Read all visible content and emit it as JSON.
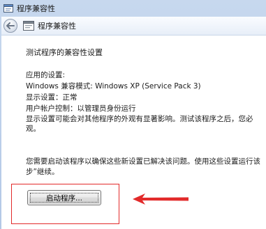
{
  "window": {
    "title": "程序兼容性"
  },
  "navbar": {
    "title": "程序兼容性"
  },
  "content": {
    "heading": "测试程序的兼容性设置",
    "applied_label": "应用的设置:",
    "compat_mode": "Windows 兼容模式: Windows XP (Service Pack 3)",
    "display_setting": "显示设置：正常",
    "uac": "用户帐户控制：以管理员身份运行",
    "warning_line1": "显示设置可能会对其他程序的外观有显著影响。测试该程序之后，您必",
    "warning_line2": "观。",
    "instruction_line1": "您需要启动该程序以确保这些新设置已解决该问题。使用这些设置运行该",
    "instruction_line2": "步”继续。",
    "start_button": "启动程序..."
  },
  "colors": {
    "highlight_box": "#e22a2a",
    "arrow": "#e22a2a"
  },
  "icons": {
    "title": "program-window-icon",
    "back": "back-arrow-icon",
    "nav": "program-window-icon"
  }
}
